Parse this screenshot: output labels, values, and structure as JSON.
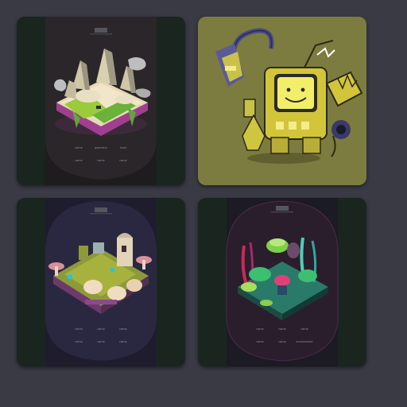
{
  "gallery": {
    "cards": [
      {
        "name": "floating-ruins-island",
        "bg": "#1a2520",
        "panel": "#1e1c1f",
        "captions": [
          "name",
          "geometry",
          "level",
          "name",
          "name",
          "name"
        ]
      },
      {
        "name": "yellow-robot-character",
        "bg": "#7c7c40"
      },
      {
        "name": "isometric-village-platform",
        "bg": "#1a2520",
        "panel": "#1f1c2e",
        "captions": [
          "name",
          "name",
          "name",
          "name",
          "name",
          "name"
        ]
      },
      {
        "name": "jungle-plant-island",
        "bg": "#1a2520",
        "panel": "#1c1a22",
        "captions": [
          "name",
          "name",
          "name",
          "name",
          "name",
          "environment"
        ]
      }
    ]
  }
}
